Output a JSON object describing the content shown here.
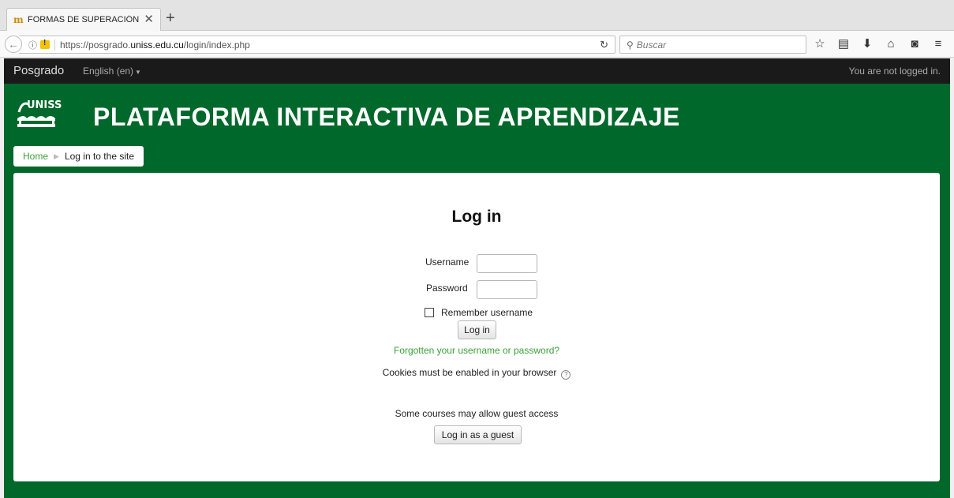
{
  "browser": {
    "tab_title": "FORMAS DE SUPERACIÓN...",
    "tab_close": "✕",
    "new_tab": "+",
    "url_prefix": "https://posgrado.",
    "url_domain": "uniss.edu.cu",
    "url_path": "/login/index.php",
    "search_placeholder": "Buscar"
  },
  "topbar": {
    "brand": "Posgrado",
    "language": "English (en)",
    "login_status": "You are not logged in."
  },
  "header": {
    "logo_text": "UNISS",
    "site_title": "PLATAFORMA INTERACTIVA DE APRENDIZAJE"
  },
  "breadcrumb": {
    "home": "Home",
    "current": "Log in to the site"
  },
  "login": {
    "heading": "Log in",
    "username_label": "Username",
    "username_value": "",
    "password_label": "Password",
    "password_value": "",
    "remember_label": "Remember username",
    "login_button": "Log in",
    "forgot_link": "Forgotten your username or password?",
    "cookies_note": "Cookies must be enabled in your browser",
    "guest_note": "Some courses may allow guest access",
    "guest_button": "Log in as a guest"
  },
  "colors": {
    "page_green": "#00682a",
    "link_green": "#3aa13a",
    "topbar": "#1a1a1a"
  }
}
